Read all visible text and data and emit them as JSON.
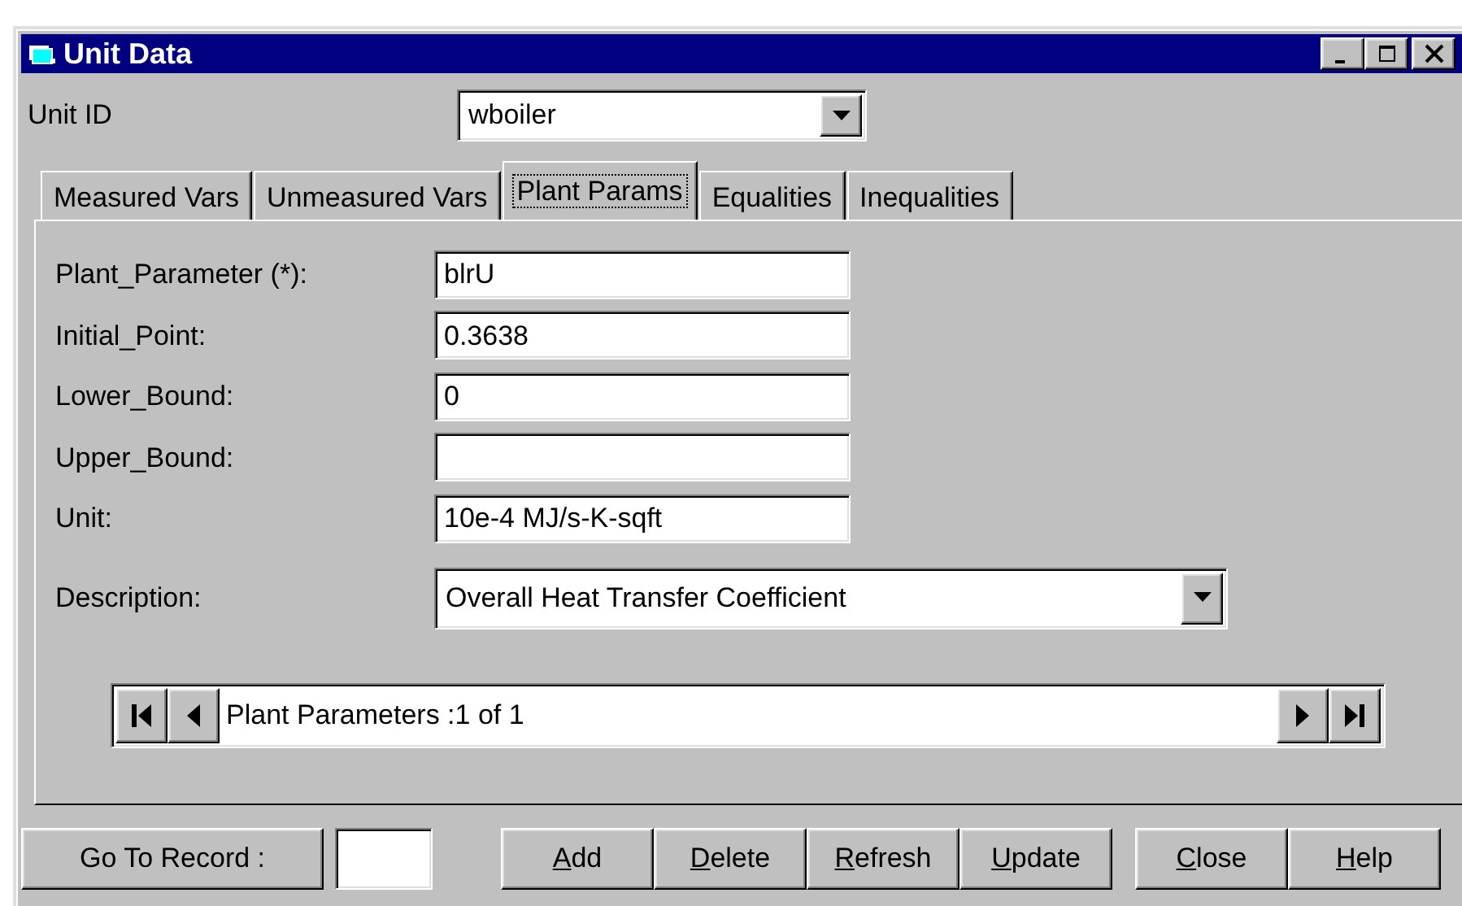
{
  "window": {
    "title": "Unit Data"
  },
  "unit_id": {
    "label": "Unit ID",
    "value": "wboiler"
  },
  "tabs": [
    {
      "label": "Measured Vars",
      "selected": false
    },
    {
      "label": "Unmeasured Vars",
      "selected": false
    },
    {
      "label": "Plant Params",
      "selected": true
    },
    {
      "label": "Equalities",
      "selected": false
    },
    {
      "label": "Inequalities",
      "selected": false
    }
  ],
  "fields": [
    {
      "label": "Plant_Parameter (*):",
      "value": "blrU",
      "kind": "text"
    },
    {
      "label": "Initial_Point:",
      "value": "0.3638",
      "kind": "text"
    },
    {
      "label": "Lower_Bound:",
      "value": "0",
      "kind": "text"
    },
    {
      "label": "Upper_Bound:",
      "kind": "text"
    },
    {
      "label": "Unit:",
      "value": "10e-4 MJ/s-K-sqft",
      "kind": "text"
    },
    {
      "label": "Description:",
      "value": "Overall Heat Transfer Coefficient",
      "kind": "combo"
    }
  ],
  "navigator": {
    "caption": "Plant Parameters :1 of 1"
  },
  "go_to_record": {
    "label": "Go To Record :"
  },
  "buttons": [
    {
      "label": "Add",
      "underlined_first_letter": true
    },
    {
      "label": "Delete",
      "underlined_first_letter": true
    },
    {
      "label": "Refresh",
      "underlined_first_letter": true
    },
    {
      "label": "Update",
      "underlined_first_letter": true
    },
    {
      "label": "Close",
      "underlined_first_letter": true
    },
    {
      "label": "Help",
      "underlined_first_letter": true
    }
  ]
}
